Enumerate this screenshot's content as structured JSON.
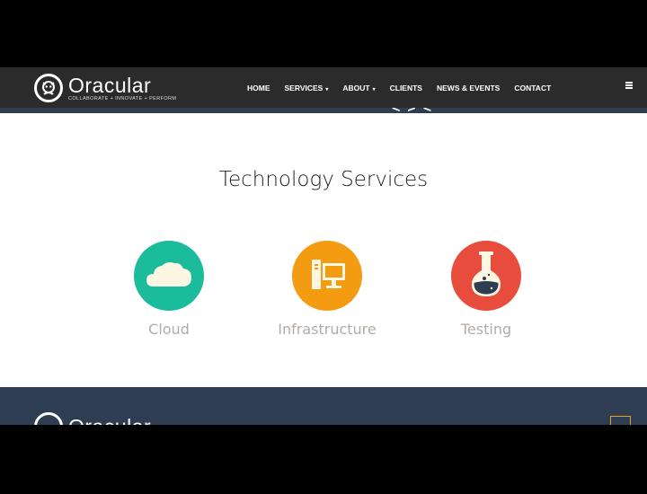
{
  "brand": {
    "name": "Oracular",
    "tagline": "COLLABORATE + INNOVATE + PERFORM",
    "logo_icon": "oracle-face-icon"
  },
  "nav": {
    "items": [
      {
        "label": "HOME",
        "has_dropdown": false
      },
      {
        "label": "SERVICES",
        "has_dropdown": true
      },
      {
        "label": "ABOUT",
        "has_dropdown": true
      },
      {
        "label": "CLIENTS",
        "has_dropdown": false
      },
      {
        "label": "NEWS & EVENTS",
        "has_dropdown": false
      },
      {
        "label": "CONTACT",
        "has_dropdown": false
      }
    ],
    "menu_icon": "hamburger-icon"
  },
  "section": {
    "title": "Technology Services"
  },
  "services": [
    {
      "label": "Cloud",
      "icon": "cloud-icon",
      "color": "#1abc9c"
    },
    {
      "label": "Infrastructure",
      "icon": "computer-icon",
      "color": "#f39c12"
    },
    {
      "label": "Testing",
      "icon": "flask-icon",
      "color": "#e74c3c"
    }
  ],
  "footer": {
    "brand_name": "Oracular"
  },
  "colors": {
    "navbar": "#2b2b2b",
    "footer": "#2e3d51",
    "scroll_top_border": "#e9a024"
  }
}
